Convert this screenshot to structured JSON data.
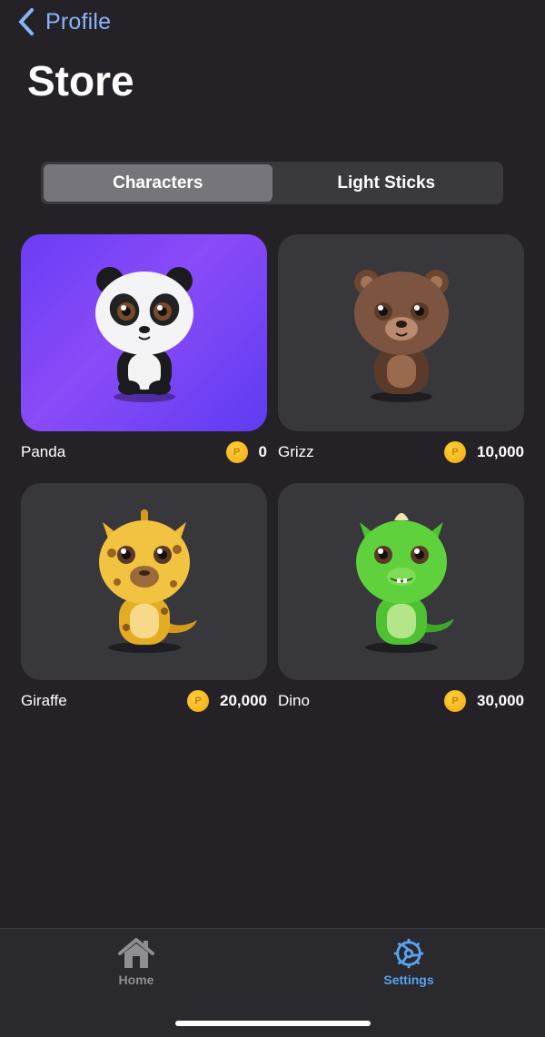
{
  "nav": {
    "back_label": "Profile"
  },
  "page": {
    "title": "Store"
  },
  "segments": [
    {
      "label": "Characters",
      "active": true
    },
    {
      "label": "Light Sticks",
      "active": false
    }
  ],
  "items": [
    {
      "name": "Panda",
      "price": "0",
      "selected": true,
      "icon": "panda-icon"
    },
    {
      "name": "Grizz",
      "price": "10,000",
      "selected": false,
      "icon": "bear-icon"
    },
    {
      "name": "Giraffe",
      "price": "20,000",
      "selected": false,
      "icon": "giraffe-icon"
    },
    {
      "name": "Dino",
      "price": "30,000",
      "selected": false,
      "icon": "dino-icon"
    }
  ],
  "coin": {
    "symbol": "P"
  },
  "tabbar": {
    "home_label": "Home",
    "settings_label": "Settings",
    "active": "settings"
  },
  "colors": {
    "accent": "#5aa3f0",
    "back_link": "#8ab4f8",
    "selected_gradient_start": "#6a3df5",
    "selected_gradient_end": "#8a4bf8",
    "coin": "#f7b90f"
  }
}
